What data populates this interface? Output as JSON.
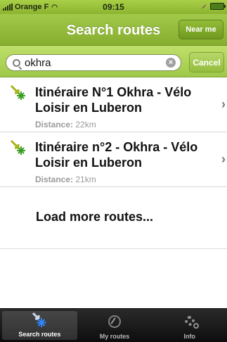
{
  "status_bar": {
    "carrier": "Orange F",
    "time": "09:15"
  },
  "nav": {
    "title": "Search routes",
    "near_me": "Near me"
  },
  "search": {
    "value": "okhra",
    "placeholder": "",
    "cancel": "Cancel"
  },
  "results": [
    {
      "title": "Itinéraire N°1 Okhra - Vélo Loisir en Luberon",
      "distance_label": "Distance:",
      "distance_value": "22km"
    },
    {
      "title": "Itinéraire n°2 - Okhra - Vélo Loisir en Luberon",
      "distance_label": "Distance:",
      "distance_value": "21km"
    }
  ],
  "load_more": "Load more routes...",
  "tabs": [
    {
      "label": "Search routes",
      "icon": "route-star-icon",
      "active": true
    },
    {
      "label": "My routes",
      "icon": "compass-icon",
      "active": false
    },
    {
      "label": "Info",
      "icon": "gear-icon",
      "active": false
    }
  ],
  "colors": {
    "accent_green": "#93bd37",
    "tab_bar": "#1a1a1a",
    "route_icon": "#3a9e1f",
    "route_arrow": "#a8b317"
  }
}
